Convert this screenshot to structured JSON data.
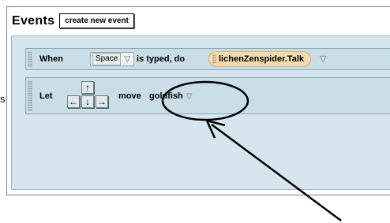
{
  "edge_letter": "s",
  "events": {
    "title": "Events",
    "create_button": "create new event",
    "when_block": {
      "when_label": "When",
      "key_value": "Space",
      "typed_label": "is typed, do",
      "method_value": "lichenZenspider.Talk"
    },
    "let_block": {
      "let_label": "Let",
      "arrow_up": "↑",
      "arrow_left": "←",
      "arrow_down": "↓",
      "arrow_right": "→",
      "move_label": "move",
      "object_value": "goldfish"
    }
  },
  "dropdown_glyph": "▽",
  "colors": {
    "workspace": "#d6e5ee",
    "block": "#c9dee6",
    "method_pill": "#f3ddb0",
    "annotation": "#000000"
  }
}
